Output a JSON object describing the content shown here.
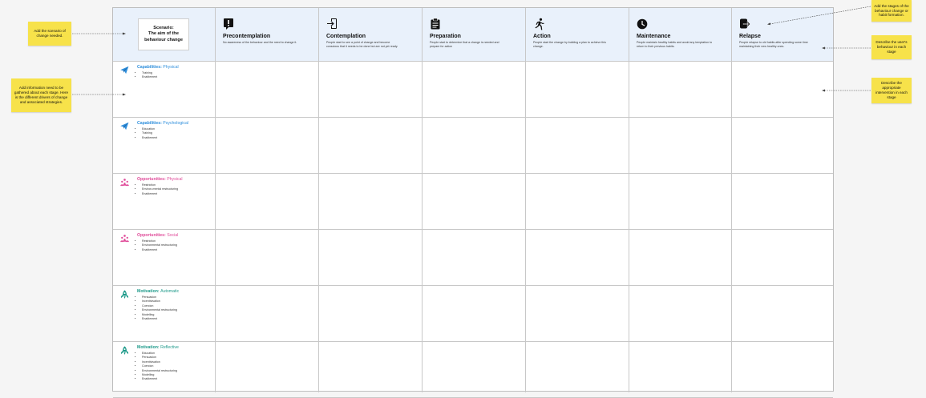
{
  "scenario": {
    "text": "Scenario:\nThe aim of the\nbehaviour change"
  },
  "stages": [
    {
      "icon": "exclamation-icon",
      "title": "Precontemplation",
      "desc": "No awareness of the behaviour and the need to change it."
    },
    {
      "icon": "enter-icon",
      "title": "Contemplation",
      "desc": "People start to see a point of change and become conscious that it needs to be done but are not yet ready."
    },
    {
      "icon": "clipboard-icon",
      "title": "Preparation",
      "desc": "People start to determine that a change is needed and prepare for action"
    },
    {
      "icon": "running-icon",
      "title": "Action",
      "desc": "People start the change by building a plan to achieve this change."
    },
    {
      "icon": "clock-icon",
      "title": "Maintenance",
      "desc": "People maintain healthy habits and avoid any temptation to return to their previous habits."
    },
    {
      "icon": "exit-icon",
      "title": "Relapse",
      "desc": "People relapse to old habits after spending some time maintaining their new healthy ones."
    }
  ],
  "rows": [
    {
      "icon": "paper-plane-icon",
      "category": "Capabilities:",
      "sub": "Physical",
      "color": "#2f8fdc",
      "items": [
        "Training",
        "Enablement"
      ]
    },
    {
      "icon": "paper-plane-icon",
      "category": "Capabilities:",
      "sub": "Psychological",
      "color": "#2f8fdc",
      "items": [
        "Education",
        "Training",
        "Enablement"
      ]
    },
    {
      "icon": "people-icon",
      "category": "Opportunities:",
      "sub": "Physical",
      "color": "#e04c9a",
      "items": [
        "Restriction",
        "Environ-mental restructuring",
        "Enablement"
      ]
    },
    {
      "icon": "people-icon",
      "category": "Opportunities:",
      "sub": "Social",
      "color": "#e04c9a",
      "items": [
        "Restriction",
        "Environmental restructuring",
        "Enablement"
      ]
    },
    {
      "icon": "rocket-icon",
      "category": "Motivation:",
      "sub": "Automatic",
      "color": "#1e9a8a",
      "items": [
        "Persuasion",
        "Incentivisation",
        "Coercion",
        "Environmental restructuring",
        "Modelling",
        "Enablement"
      ]
    },
    {
      "icon": "rocket-icon",
      "category": "Motivation:",
      "sub": "Reflective",
      "color": "#1e9a8a",
      "items": [
        "Education",
        "Persuasion",
        "Incentivisation",
        "Coercion",
        "Environmental restructuring",
        "Modelling",
        "Enablement"
      ]
    }
  ],
  "notes": {
    "scenario": "Add the scenario of change needed.",
    "drivers": "Add information need to be gathered about each stage. Here is the different drivers of change and associated strategies.",
    "stages": "Add the stages of the behaviour change or habit formation.",
    "behaviour": "Describe the user's behaviour in each stage",
    "intervention": "Describe the appropriate intervention in each stage"
  },
  "colors": {
    "header_bg": "#e9f1fb",
    "sticky": "#f7e24a",
    "capabilities": "#2f8fdc",
    "opportunities": "#e04c9a",
    "motivation": "#1e9a8a"
  }
}
